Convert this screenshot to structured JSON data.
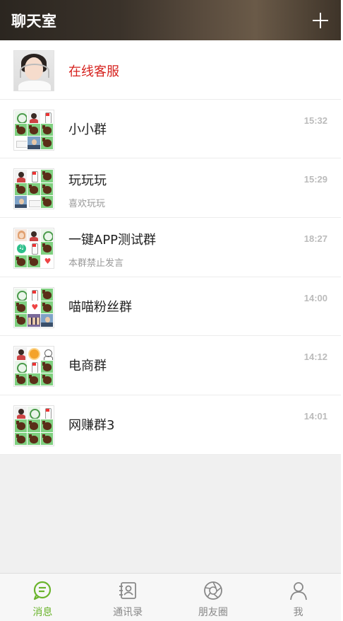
{
  "header": {
    "title": "聊天室",
    "add_icon": "plus-icon"
  },
  "conversations": [
    {
      "name": "在线客服",
      "time": "",
      "preview": "",
      "avatar": "customer-service-avatar"
    },
    {
      "name": "小小群",
      "time": "15:32",
      "preview": "",
      "avatar": "group-avatar"
    },
    {
      "name": "玩玩玩",
      "time": "15:29",
      "preview": "喜欢玩玩",
      "avatar": "group-avatar"
    },
    {
      "name": "一键APP测试群",
      "time": "18:27",
      "preview": "本群禁止发言",
      "avatar": "group-avatar"
    },
    {
      "name": "喵喵粉丝群",
      "time": "14:00",
      "preview": "",
      "avatar": "group-avatar"
    },
    {
      "name": "电商群",
      "time": "14:12",
      "preview": "",
      "avatar": "group-avatar"
    },
    {
      "name": "网赚群3",
      "time": "14:01",
      "preview": "",
      "avatar": "group-avatar"
    }
  ],
  "tabbar": {
    "items": [
      {
        "label": "消息",
        "icon": "chat-bubble-icon",
        "active": true
      },
      {
        "label": "通讯录",
        "icon": "contacts-icon",
        "active": false
      },
      {
        "label": "朋友圈",
        "icon": "camera-aperture-icon",
        "active": false
      },
      {
        "label": "我",
        "icon": "person-icon",
        "active": false
      }
    ],
    "active_color": "#6ab42c",
    "inactive_color": "#888888"
  },
  "colors": {
    "header_bg": "#3a322a",
    "service_name": "#d6221e",
    "time_text": "#bbbbbb"
  }
}
